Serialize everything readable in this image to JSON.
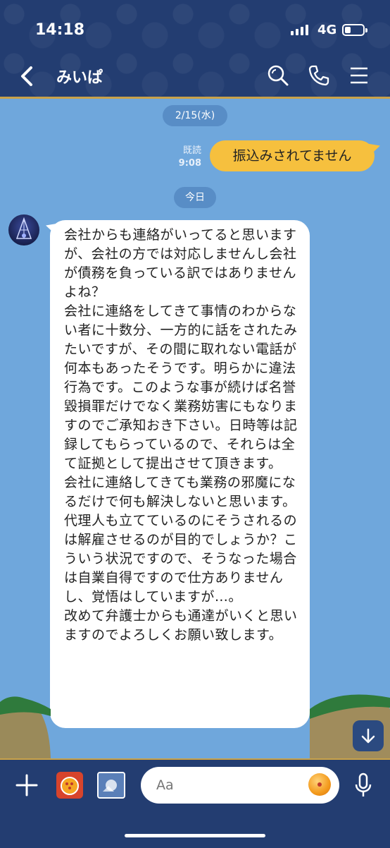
{
  "status_bar": {
    "time": "14:18",
    "network": "4G"
  },
  "header": {
    "title": "みいぱ"
  },
  "chat": {
    "date_label": "2/15(水)",
    "read_label": "既読",
    "read_time": "9:08",
    "my_message": "振込みされてません",
    "today_label": "今日",
    "their_message": "会社からも連絡がいってると思いますが、会社の方では対応しませんし会社が債務を負っている訳ではありませんよね？\n会社に連絡をしてきて事情のわからない者に十数分、一方的に話をされたみたいですが、その間に取れない電話が何本もあったそうです。明らかに違法行為です。このような事が続けば名誉毀損罪だけでなく業務妨害にもなりますのでご承知おき下さい。日時等は記録してもらっているので、それらは全て証拠として提出させて頂きます。\n会社に連絡してきても業務の邪魔になるだけで何も解決しないと思います。代理人も立てているのにそうされるのは解雇させるのが目的でしょうか？こういう状況ですので、そうなった場合は自業自得ですので仕方ありませんし、覚悟はしていますが…。\n改めて弁護士からも通達がいくと思いますのでよろしくお願い致します。"
  },
  "input": {
    "placeholder": "Aa"
  },
  "colors": {
    "header_bg": "#233d71",
    "chat_bg": "#6fa7dc",
    "my_bubble": "#f6c03e",
    "accent_border": "#c9a24a"
  }
}
